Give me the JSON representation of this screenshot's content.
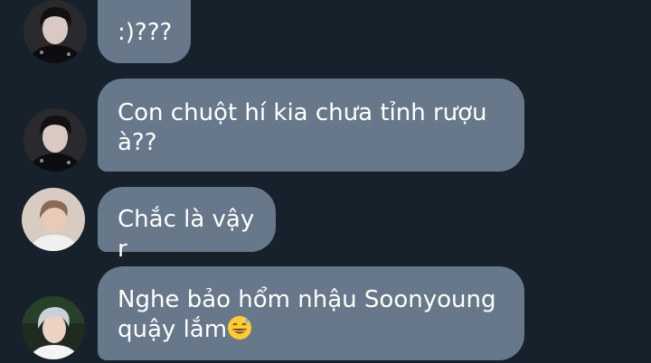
{
  "colors": {
    "background": "#17212b",
    "bubble": "#66788a",
    "text": "#ffffff"
  },
  "messages": [
    {
      "avatar": "avatar-user-1",
      "text": ":)???"
    },
    {
      "avatar": "avatar-user-1",
      "lines": [
        "Con chuột hí kia chưa tỉnh rượu",
        "à??"
      ]
    },
    {
      "avatar": "avatar-user-2",
      "text": "Chắc là vậy r"
    },
    {
      "avatar": "avatar-user-3",
      "lines": [
        "Nghe bảo hổm nhậu Soonyoung",
        "quậy lắm"
      ],
      "emoji": "grinning-sweat-emoji"
    }
  ]
}
